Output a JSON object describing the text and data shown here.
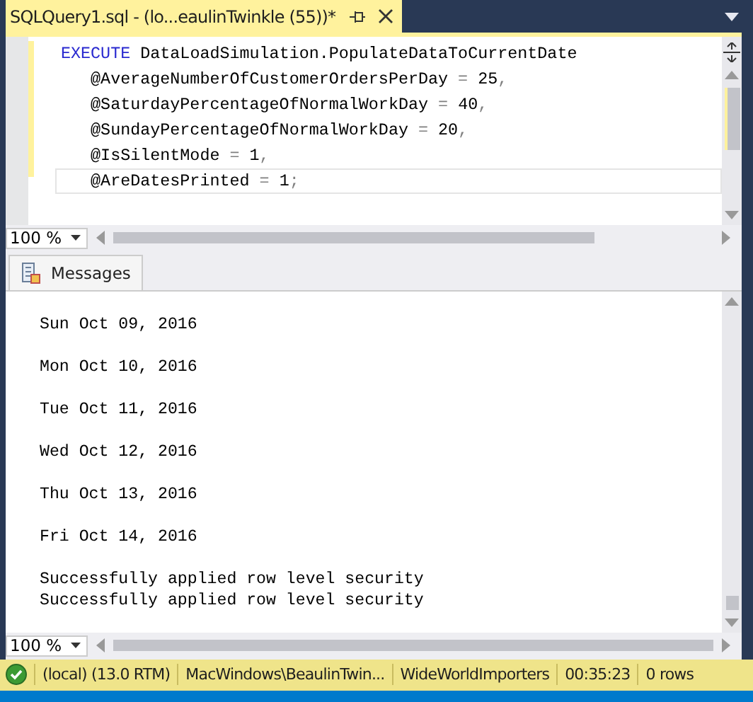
{
  "document_tab": {
    "title": "SQLQuery1.sql - (lo...eaulinTwinkle (55))*",
    "selected": true
  },
  "editor": {
    "lines": [
      {
        "current": false,
        "tokens": [
          {
            "kind": "keyword",
            "text": "EXECUTE"
          },
          {
            "kind": "plain",
            "text": " DataLoadSimulation.PopulateDataToCurrentDate"
          }
        ]
      },
      {
        "current": false,
        "tokens": [
          {
            "kind": "plain",
            "text": "   @AverageNumberOfCustomerOrdersPerDay"
          },
          {
            "kind": "operator",
            "text": " = "
          },
          {
            "kind": "plain",
            "text": "25"
          },
          {
            "kind": "operator",
            "text": ","
          }
        ]
      },
      {
        "current": false,
        "tokens": [
          {
            "kind": "plain",
            "text": "   @SaturdayPercentageOfNormalWorkDay"
          },
          {
            "kind": "operator",
            "text": " = "
          },
          {
            "kind": "plain",
            "text": "40"
          },
          {
            "kind": "operator",
            "text": ","
          }
        ]
      },
      {
        "current": false,
        "tokens": [
          {
            "kind": "plain",
            "text": "   @SundayPercentageOfNormalWorkDay"
          },
          {
            "kind": "operator",
            "text": " = "
          },
          {
            "kind": "plain",
            "text": "20"
          },
          {
            "kind": "operator",
            "text": ","
          }
        ]
      },
      {
        "current": false,
        "tokens": [
          {
            "kind": "plain",
            "text": "   @IsSilentMode"
          },
          {
            "kind": "operator",
            "text": " = "
          },
          {
            "kind": "plain",
            "text": "1"
          },
          {
            "kind": "operator",
            "text": ","
          }
        ]
      },
      {
        "current": true,
        "tokens": [
          {
            "kind": "plain",
            "text": "   @AreDatesPrinted"
          },
          {
            "kind": "operator",
            "text": " = "
          },
          {
            "kind": "plain",
            "text": "1"
          },
          {
            "kind": "operator",
            "text": ";"
          }
        ]
      }
    ],
    "zoom": "100 %"
  },
  "results": {
    "tabs": [
      {
        "label": "Messages",
        "selected": true
      }
    ],
    "messages": [
      {
        "lines": [
          "Sun Oct 09, 2016"
        ]
      },
      {
        "lines": [
          "Mon Oct 10, 2016"
        ]
      },
      {
        "lines": [
          "Tue Oct 11, 2016"
        ]
      },
      {
        "lines": [
          "Wed Oct 12, 2016"
        ]
      },
      {
        "lines": [
          "Thu Oct 13, 2016"
        ]
      },
      {
        "lines": [
          "Fri Oct 14, 2016"
        ]
      },
      {
        "lines": [
          "Successfully applied row level security",
          "Successfully applied row level security"
        ]
      }
    ],
    "zoom": "100 %"
  },
  "status_bar": {
    "succeeded": true,
    "items": [
      "(local) (13.0 RTM)",
      "MacWindows\\BeaulinTwin...",
      "WideWorldImporters",
      "00:35:23",
      "0 rows"
    ]
  }
}
